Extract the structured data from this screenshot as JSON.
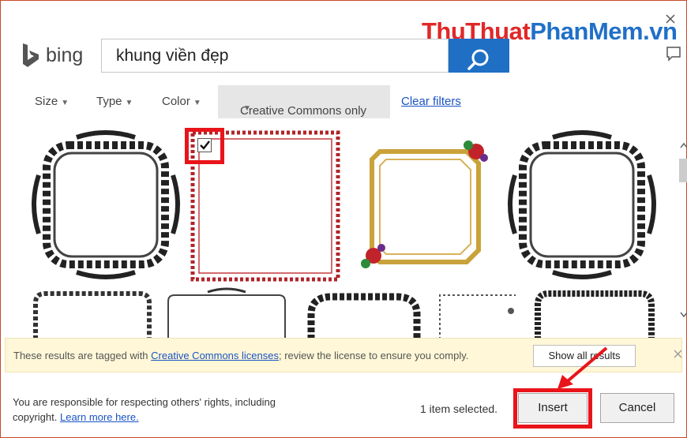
{
  "watermark": {
    "part1": "ThuThuat",
    "part2": "PhanMem.vn"
  },
  "header": {
    "logo_text": "bing",
    "search_value": "khung viền đẹp"
  },
  "filters": {
    "size": "Size",
    "type": "Type",
    "color": "Color",
    "license": "Creative Commons only",
    "clear": "Clear filters"
  },
  "icons": {
    "search": "search-icon",
    "close": "close-icon",
    "feedback": "feedback-icon",
    "check": "checkmark-icon",
    "arrow": "red-arrow-annotation"
  },
  "colors": {
    "bing_blue": "#1f6fc5",
    "highlight_red": "#e8141a",
    "link_blue": "#1a53c5",
    "notice_bg": "#fff7d7"
  },
  "notice": {
    "prefix": "These results are tagged with ",
    "link": "Creative Commons licenses",
    "suffix": "; review the license to ensure you comply.",
    "button": "Show all results"
  },
  "footer": {
    "line1": "You are responsible for respecting others' rights, including",
    "line2": "copyright. ",
    "link": "Learn more here.",
    "selected_count": "1 item selected.",
    "insert": "Insert",
    "cancel": "Cancel"
  }
}
